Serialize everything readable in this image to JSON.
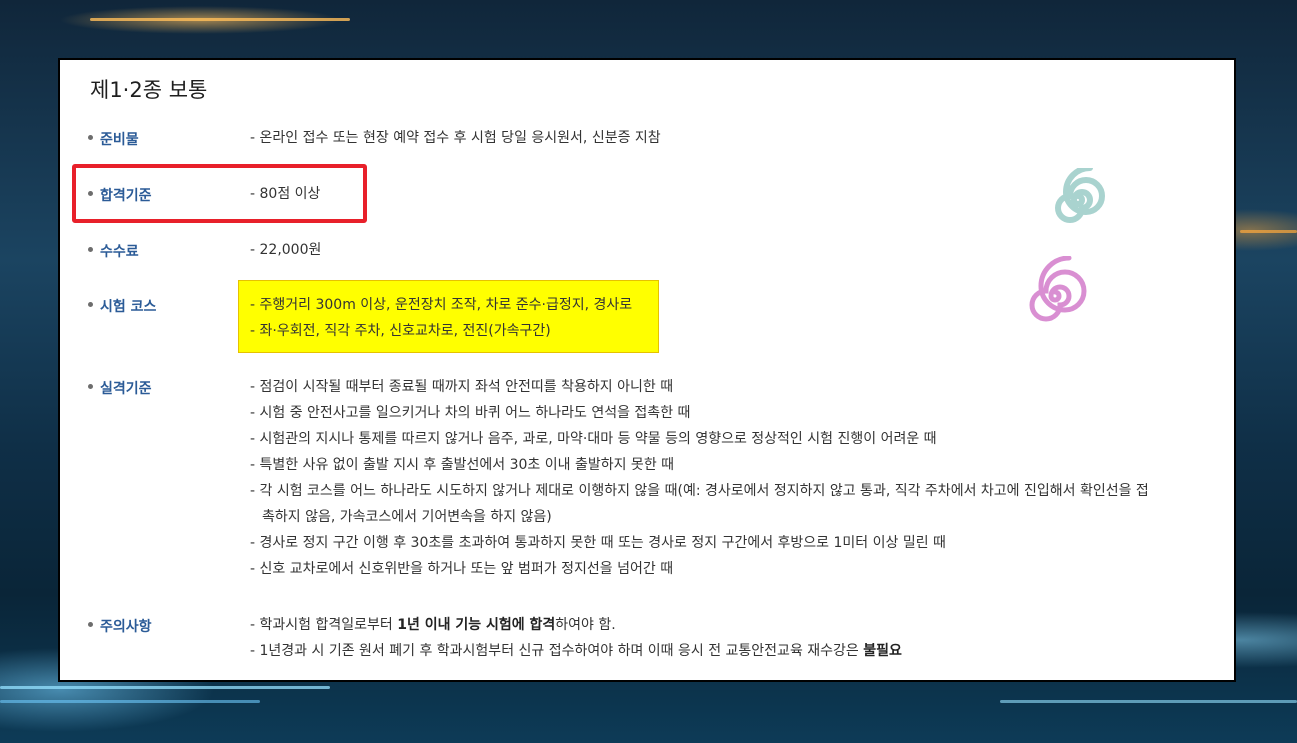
{
  "title": "제1·2종 보통",
  "sections": [
    {
      "label": "준비물",
      "lines": [
        "- 온라인 접수 또는 현장 예약 접수 후 시험 당일 응시원서, 신분증 지참"
      ]
    },
    {
      "label": "합격기준",
      "lines": [
        "- 80점 이상"
      ]
    },
    {
      "label": "수수료",
      "lines": [
        "- 22,000원"
      ]
    },
    {
      "label": "시험 코스",
      "lines": [
        "- 주행거리 300m 이상, 운전장치 조작, 차로 준수·급정지, 경사로",
        "- 좌·우회전, 직각 주차, 신호교차로, 전진(가속구간)"
      ]
    },
    {
      "label": "실격기준",
      "lines": [
        "- 점검이 시작될 때부터 종료될 때까지 좌석 안전띠를 착용하지 아니한 때",
        "- 시험 중 안전사고를 일으키거나 차의 바퀴 어느 하나라도 연석을 접촉한 때",
        "- 시험관의 지시나 통제를 따르지 않거나 음주, 과로, 마약·대마 등 약물 등의 영향으로 정상적인 시험 진행이 어려운 때",
        "- 특별한 사유 없이 출발 지시 후 출발선에서 30초 이내 출발하지 못한 때",
        "- 각 시험 코스를 어느 하나라도 시도하지 않거나 제대로 이행하지 않을 때(예: 경사로에서 정지하지 않고 통과, 직각 주차에서 차고에 진입해서 확인선을 접",
        "촉하지 않음, 가속코스에서 기어변속을 하지 않음)",
        "- 경사로 정지 구간 이행 후 30초를 초과하여 통과하지 못한 때 또는 경사로 정지 구간에서 후방으로 1미터 이상 밀린 때",
        "- 신호 교차로에서 신호위반을 하거나 또는 앞 범퍼가 정지선을 넘어간 때"
      ]
    },
    {
      "label": "주의사항",
      "lines": [
        {
          "pre": "- 학과시험 합격일로부터 ",
          "bold": "1년 이내 기능 시험에 합격",
          "post": "하여야 함."
        },
        {
          "pre": "- 1년경과 시 기존 원서 폐기 후 학과시험부터 신규 접수하여야 하며 이때 응시 전 교통안전교육 재수강은 ",
          "bold": "불필요",
          "post": ""
        }
      ]
    }
  ],
  "colors": {
    "label": "#2b5b97",
    "highlight": "#ffff00",
    "annotation_box": "#e8202a",
    "spiral_teal": "#a9d3cf",
    "spiral_pink": "#d98fd2"
  },
  "icons": [
    "spiral-teal-icon",
    "spiral-pink-icon"
  ]
}
